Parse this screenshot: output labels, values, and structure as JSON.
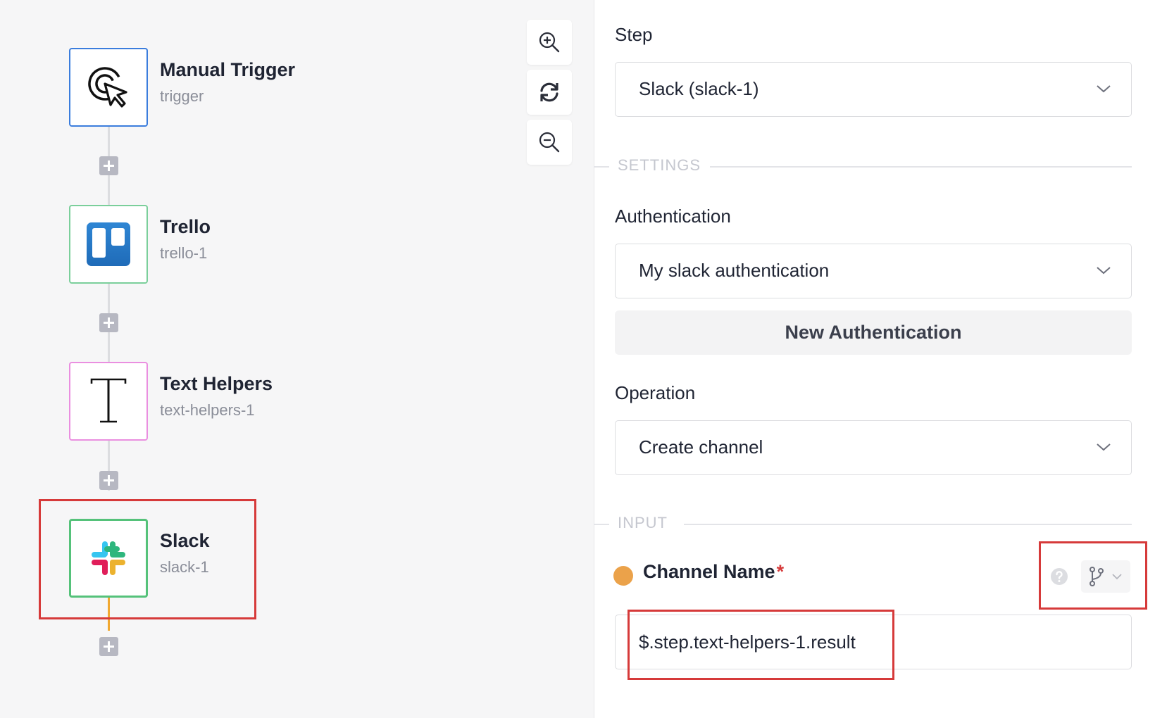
{
  "flow": {
    "nodes": [
      {
        "title": "Manual Trigger",
        "subtitle": "trigger",
        "icon": "cursor-click-icon",
        "border_color": "#3b7ddd"
      },
      {
        "title": "Trello",
        "subtitle": "trello-1",
        "icon": "trello-logo-icon",
        "border_color": "#7bcf9b"
      },
      {
        "title": "Text Helpers",
        "subtitle": "text-helpers-1",
        "icon": "text-letter-t-icon",
        "border_color": "#ea8fe0"
      },
      {
        "title": "Slack",
        "subtitle": "slack-1",
        "icon": "slack-logo-icon",
        "border_color": "#55c27a"
      }
    ],
    "accent_active": "#f1a830",
    "highlight_color": "#d63a3a"
  },
  "zoom_controls": {
    "zoom_in_icon": "zoom-in-icon",
    "reset_icon": "refresh-icon",
    "zoom_out_icon": "zoom-out-icon"
  },
  "panel": {
    "step_label": "Step",
    "step_value": "Slack (slack-1)",
    "settings_heading": "SETTINGS",
    "auth_label": "Authentication",
    "auth_value": "My slack authentication",
    "new_auth_button": "New Authentication",
    "operation_label": "Operation",
    "operation_value": "Create channel",
    "input_heading": "INPUT",
    "channel_name_label": "Channel Name",
    "required_mark": "*",
    "channel_name_value": "$.step.text-helpers-1.result",
    "status_dot_color": "#eba24a"
  }
}
